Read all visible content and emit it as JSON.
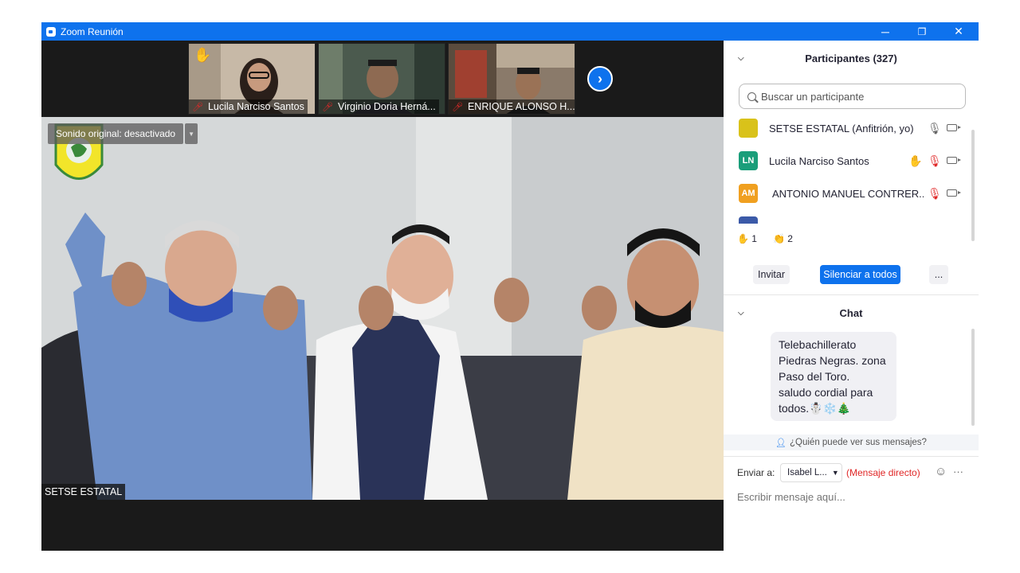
{
  "window": {
    "title": "Zoom Reunión",
    "controls": {
      "minimize": "─",
      "restore": "❐",
      "close": "✕"
    }
  },
  "thumbnails": [
    {
      "name": "Lucila Narciso Santos",
      "mic": "muted",
      "hand_raised": true
    },
    {
      "name": "Virginio Doria Herná...",
      "mic": "muted",
      "hand_raised": false
    },
    {
      "name": "ENRIQUE ALONSO H...",
      "mic": "muted",
      "hand_raised": false
    }
  ],
  "next_page_glyph": "›",
  "main_video": {
    "original_sound": "Sonido original: desactivado",
    "speaker_name": "SETSE ESTATAL"
  },
  "participants": {
    "title": "Participantes (327)",
    "search_placeholder": "Buscar un participante",
    "list": [
      {
        "name": "SETSE ESTATAL (Anfitrión, yo)",
        "initials": "",
        "avatar_color": "#d9c21a",
        "mic": "on",
        "hand_raised": false
      },
      {
        "name": "Lucila Narciso Santos",
        "initials": "LN",
        "avatar_color": "#1a9e7a",
        "mic": "muted",
        "hand_raised": true
      },
      {
        "name": "ANTONIO MANUEL CONTRER...",
        "initials": "AM",
        "avatar_color": "#f0a020",
        "mic": "muted",
        "hand_raised": false
      }
    ],
    "reactions": [
      {
        "icon": "✋",
        "count": "1"
      },
      {
        "icon": "👏",
        "count": "2"
      }
    ],
    "buttons": {
      "invite": "Invitar",
      "mute_all": "Silenciar a todos",
      "more": "..."
    }
  },
  "chat": {
    "title": "Chat",
    "messages": [
      {
        "lines": [
          "Telebachillerato",
          "Piedras Negras. zona",
          "Paso del Toro.",
          "saludo cordial para",
          "todos.☃️❄️🎄"
        ]
      }
    ],
    "who_can_see": "¿Quién puede ver sus mensajes?",
    "send_to_label": "Enviar a:",
    "recipient": "Isabel L...",
    "direct_message": "(Mensaje directo)",
    "input_placeholder": "Escribir mensaje aquí..."
  },
  "colors": {
    "accent": "#0e72ed",
    "muted": "#e02828"
  }
}
